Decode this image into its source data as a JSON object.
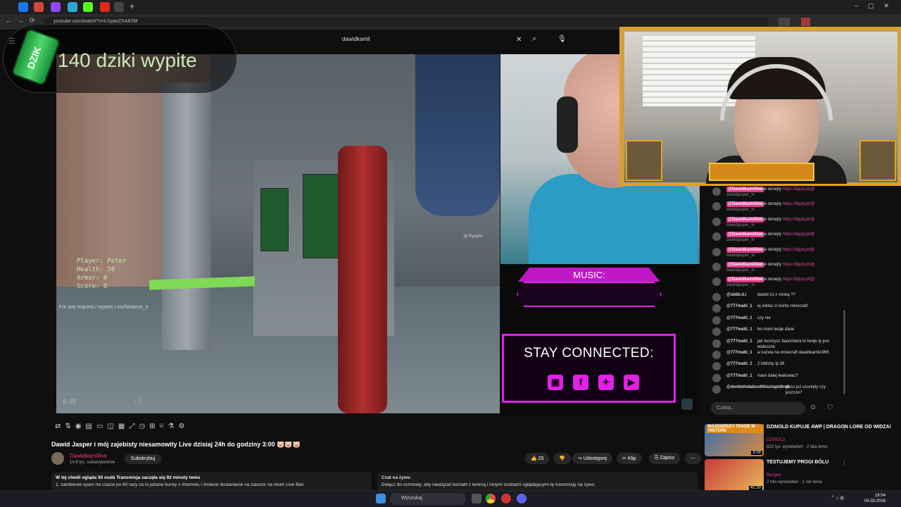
{
  "browser": {
    "url": "youtube.com/watch?v=U1pavZX4AYM"
  },
  "youtube": {
    "search_value": "dawidkamil"
  },
  "overlay": {
    "counter_text": "140 dziki wypite",
    "can_label": "DZIK"
  },
  "game": {
    "hud_player": "Player:  Peter",
    "hud_health": "Health:  50",
    "hud_armor": "Armor:   0",
    "hud_score": "Score:   0",
    "request_text": "For any request / reports t.me/binance_tr",
    "ammo_left": "88",
    "ammo_right": "0",
    "player_tag": "Jp Rysard"
  },
  "stream_overlay": {
    "music_label": "MUSIC:",
    "stay_connected": "STAY CONNECTED:"
  },
  "chat": {
    "messages": [
      {
        "name": "@Dawidkamillive",
        "msg": "moje donejty",
        "link": "https://tipply.pl/@",
        "sub": "dawidjasper_tv",
        "highlight": true
      },
      {
        "name": "@Dawidkamillive",
        "msg": "moje donejty",
        "link": "https://tipply.pl/@",
        "sub": "dawidjasper_tv",
        "highlight": true
      },
      {
        "name": "@Dawidkamillive",
        "msg": "moje donejty",
        "link": "https://tipply.pl/@",
        "sub": "dawidjasper_tv",
        "highlight": true
      },
      {
        "name": "@Dawidkamillive",
        "msg": "moje donejty",
        "link": "https://tipply.pl/@",
        "sub": "dawidjasper_tv",
        "highlight": true
      },
      {
        "name": "@Dawidkamillive",
        "msg": "moje donejty",
        "link": "https://tipply.pl/@",
        "sub": "dawidjasper_tv",
        "highlight": true
      },
      {
        "name": "@Dawidkamillive",
        "msg": "moje donejty",
        "link": "https://tipply.pl/@",
        "sub": "dawidjasper_tv",
        "highlight": true
      },
      {
        "name": "@Dawidkamillive",
        "msg": "moje donejty",
        "link": "https://tipply.pl/@",
        "sub": "dawidjasper_tv",
        "highlight": true
      },
      {
        "name": "@skibi.d.i",
        "msg": "dawid co z miską ??",
        "link": "",
        "sub": "",
        "highlight": false
      },
      {
        "name": "@777matii_1",
        "msg": "ej oddac ci konto minecraft",
        "link": "",
        "sub": "",
        "highlight": false
      },
      {
        "name": "@777matii_1",
        "msg": "czy nie",
        "link": "",
        "sub": "",
        "highlight": false
      },
      {
        "name": "@777matii_1",
        "msg": "bo mam twoje dane",
        "link": "",
        "sub": "",
        "highlight": false
      },
      {
        "name": "@777matii_1",
        "msg": "jak tworzysz tlaunchera to twoje ip jest widoczne",
        "link": "",
        "sub": "",
        "highlight": false
      },
      {
        "name": "@777matii_1",
        "msg": "a nazwa na minecraft dawidkamil1995",
        "link": "",
        "sub": "",
        "highlight": false
      },
      {
        "name": "@777matii_1",
        "msg": "2 liddzby ip 39",
        "link": "",
        "sub": "",
        "highlight": false
      },
      {
        "name": "@777matii_1",
        "msg": "mam dalej leakowac?",
        "link": "",
        "sub": "",
        "highlight": false
      },
      {
        "name": "@dontmindaboutthisstupidtroll",
        "msg": "guzo już usunięty czy jeszcze?",
        "link": "",
        "sub": "",
        "highlight": false
      }
    ],
    "input_placeholder": "Czatuj..."
  },
  "video": {
    "title": "Dawid Jasper i mój zajebisty niesamowity Live dzisiaj 24h do godziny 3:00 🐷🐷🐷",
    "channel": "Dawidkamillive",
    "subscribers": "14,6 tys. subskrybentów",
    "subscribe_label": "Subskrybuj",
    "likes": "25",
    "share_label": "Udostępnij",
    "clip_label": "Klip",
    "save_label": "Zapisz",
    "more_label": "⋯",
    "desc_line1": "W tej chwili ogląda 50 osób  Transmisja zaczęła się 92 minuty temu",
    "desc_line2": "1. zarobienie spam na czacie po 60 razy za to jebane kurwy z internetu i śmiecie dostaniecie na zawsze na moim Live Ban",
    "live_chat_title": "Czat na żywo",
    "live_chat_text": "Dołącz do rozmowy, aby nawiązać kontakt z twórcą i innymi osobami oglądającymi tę transmisję na żywo."
  },
  "recommendations": [
    {
      "title": "DZINOLD KUPUJE AWP | DRAGON LORE OD WIDZA!",
      "channel": "DZINOLD",
      "meta": "823 tys. wyświetleń · 2 lata temu",
      "thumb_text": "NAJGORSZY TRADE W HISTORII",
      "duration": "9:08"
    },
    {
      "title": "TESTUJEMY PROGI BÓLU",
      "channel": "Bungee",
      "meta": "2 mln wyświetleń · 1 rok temu",
      "thumb_text": "",
      "duration": "41:30"
    }
  ],
  "taskbar": {
    "search_placeholder": "Wyszukaj",
    "time": "16:04",
    "date": "04.03.2026"
  },
  "colors": {
    "accent_pink": "#e021e6",
    "chat_highlight": "#e03a8c",
    "webcam_frame": "#e4a020",
    "hud_green": "#c9e7a0"
  }
}
